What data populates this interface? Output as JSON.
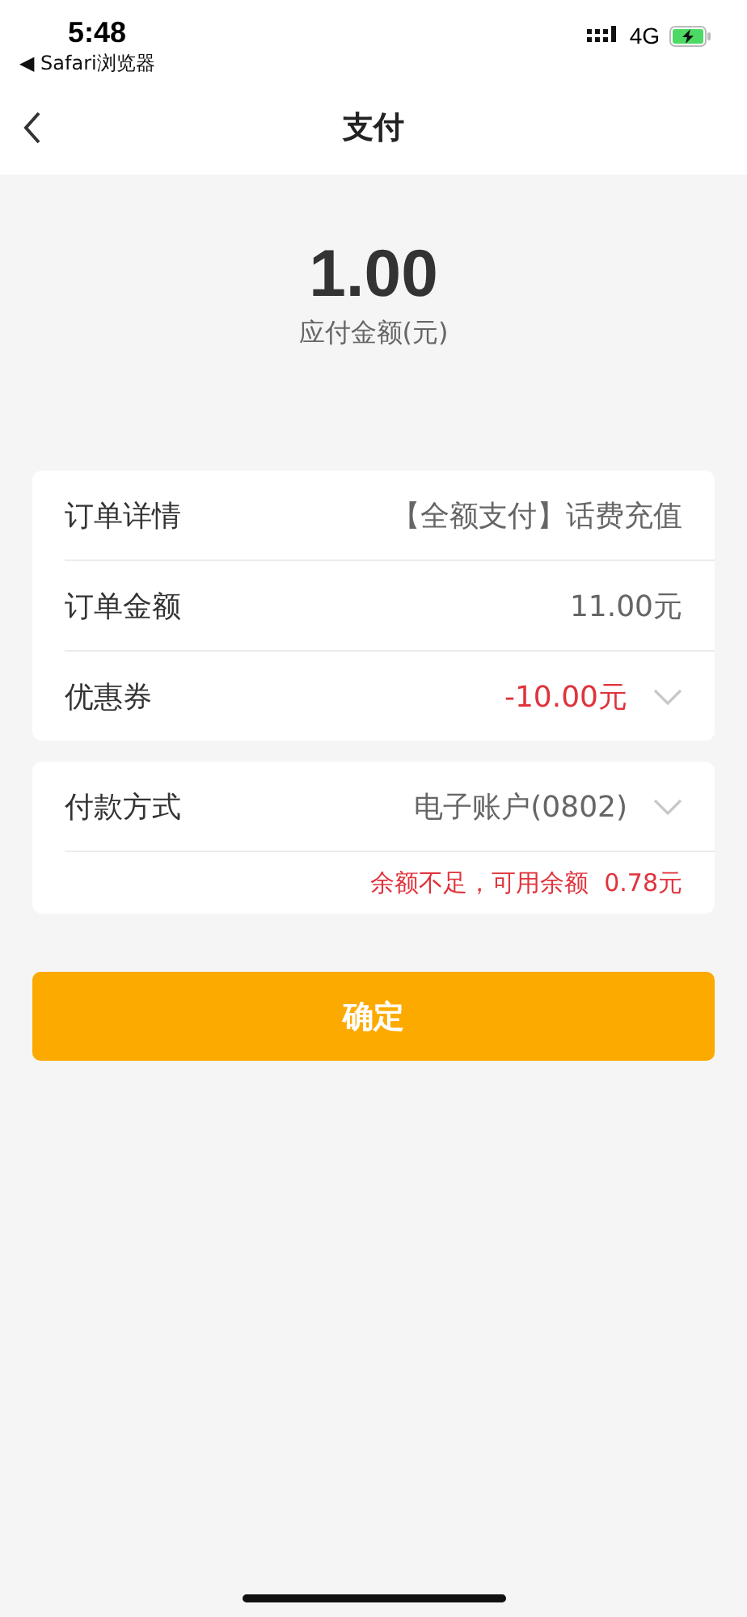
{
  "status_bar": {
    "time": "5:48",
    "back_app": "◀ Safari浏览器",
    "network": "4G"
  },
  "nav": {
    "title": "支付"
  },
  "amount": {
    "value": "1.00",
    "label": "应付金额(元)"
  },
  "order_card": {
    "rows": [
      {
        "kind": "plain",
        "label": "订单详情",
        "value": "【全额支付】话费充值",
        "highlight": false
      },
      {
        "kind": "plain",
        "label": "订单金额",
        "value": "11.00元",
        "highlight": false
      },
      {
        "kind": "dropdown",
        "label": "优惠券",
        "value": "-10.00元",
        "highlight": true
      }
    ]
  },
  "payment_card": {
    "rows": [
      {
        "kind": "dropdown",
        "label": "付款方式",
        "value": "电子账户(0802)",
        "highlight": false
      }
    ],
    "warning": "余额不足，可用余额  0.78元"
  },
  "confirm_button": "确定"
}
